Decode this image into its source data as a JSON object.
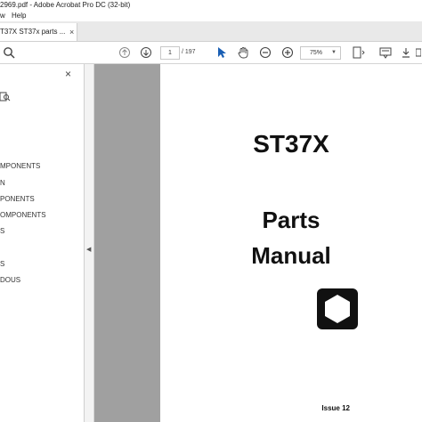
{
  "window": {
    "title": "2969.pdf - Adobe Acrobat Pro DC (32-bit)"
  },
  "menu": {
    "items": [
      "w",
      "Help"
    ]
  },
  "tab": {
    "label": "T37X ST37x parts ...",
    "close": "×"
  },
  "toolbar": {
    "page_current": "1",
    "page_total": "/ 197",
    "zoom": "75%",
    "icons": [
      "search-icon",
      "prev-page-icon",
      "next-page-icon",
      "select-cursor-icon",
      "hand-icon",
      "zoom-out-icon",
      "zoom-in-icon",
      "page-fit-icon",
      "annotate-icon",
      "download-icon",
      "more-icon"
    ]
  },
  "sidebar": {
    "close": "×",
    "bookmarks": [
      "MPONENTS",
      "N",
      "PONENTS",
      "OMPONENTS",
      "S",
      "S",
      "DOUS"
    ]
  },
  "document": {
    "title": "ST37X",
    "parts": "Parts",
    "manual": "Manual",
    "issue": "Issue 12"
  }
}
